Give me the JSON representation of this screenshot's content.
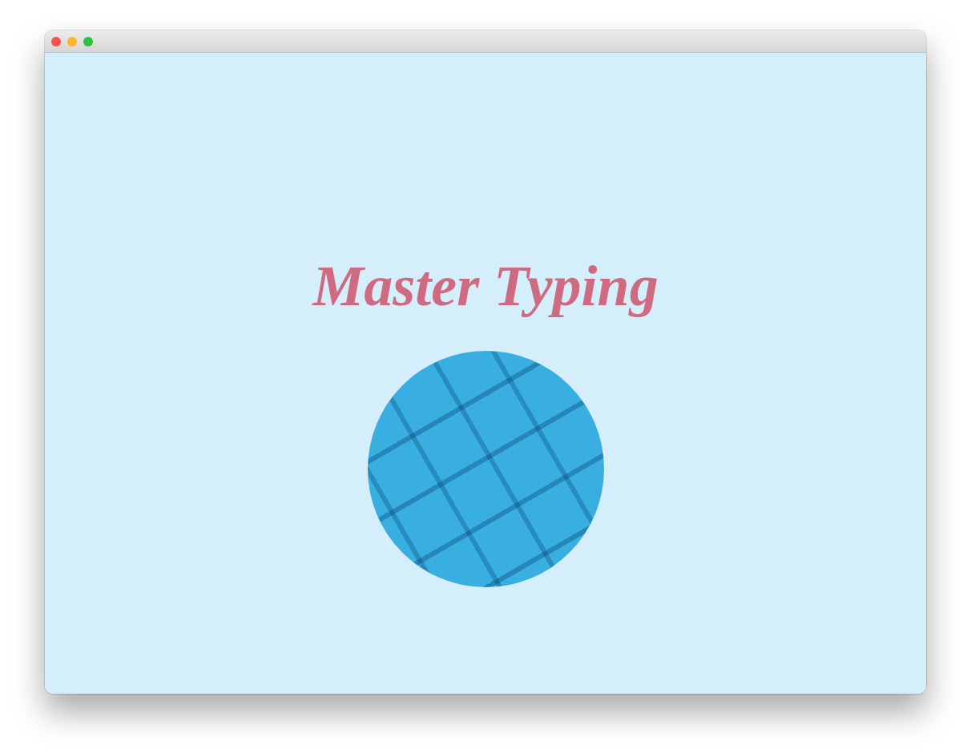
{
  "heading": "Master Typing",
  "photo": {
    "kind": "keyboard-photo"
  }
}
